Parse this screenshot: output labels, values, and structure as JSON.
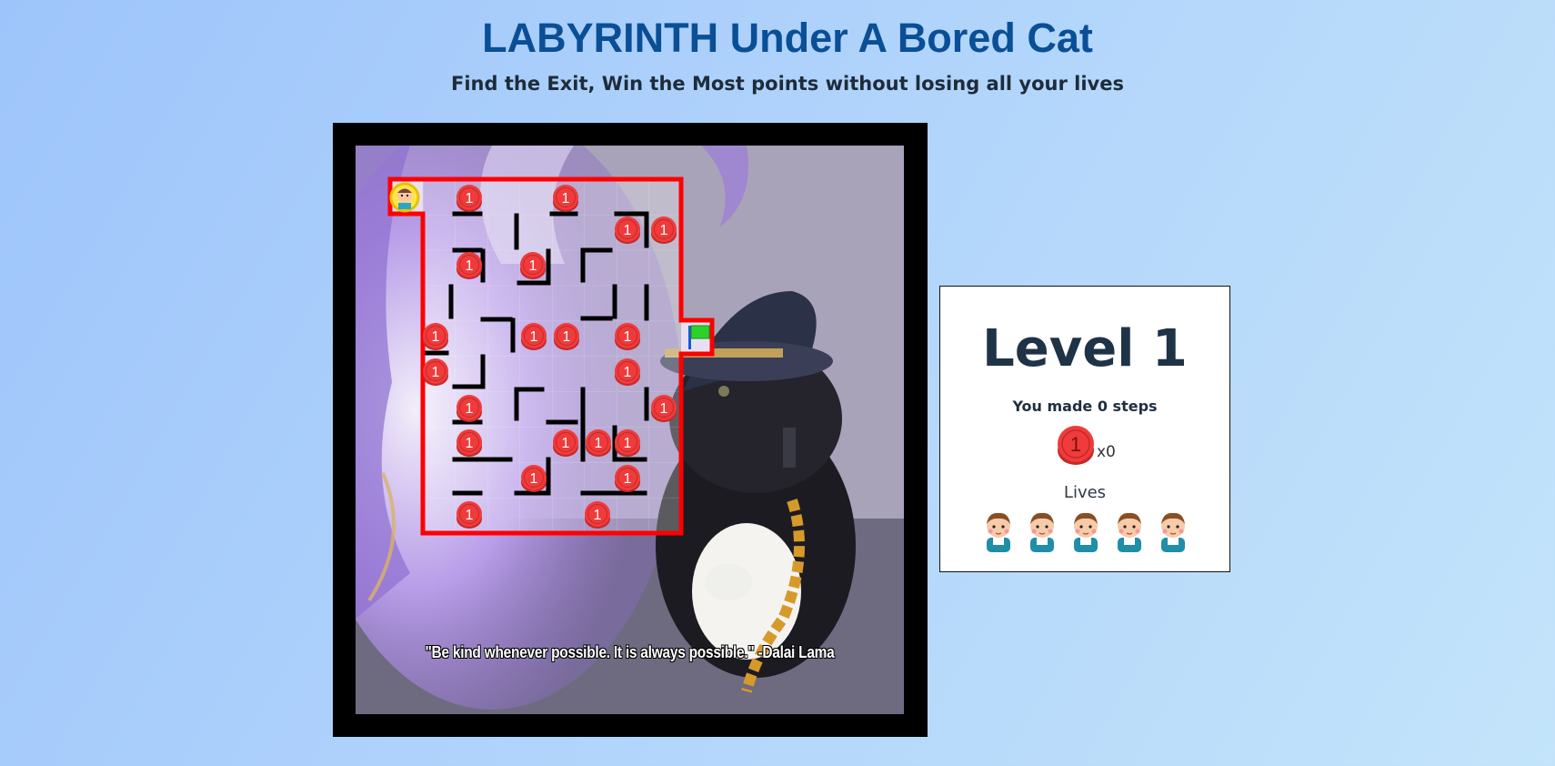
{
  "header": {
    "title": "LABYRINTH Under A Bored Cat",
    "subtitle": "Find the Exit, Win the Most points without losing all your lives"
  },
  "board": {
    "quote": "\"Be kind whenever possible. It is always possible.\" -Dalai Lama",
    "coin_label": "1",
    "colors": {
      "maze_border": "#ff0000",
      "wall": "#000000",
      "coin": "#ef3b3b",
      "exit_flag": "#2bd22b"
    }
  },
  "stats": {
    "level_label": "Level 1",
    "steps_text": "You made 0 steps",
    "coin_label": "1",
    "coin_count_text": "x0",
    "lives_label": "Lives",
    "lives_count": 5
  }
}
